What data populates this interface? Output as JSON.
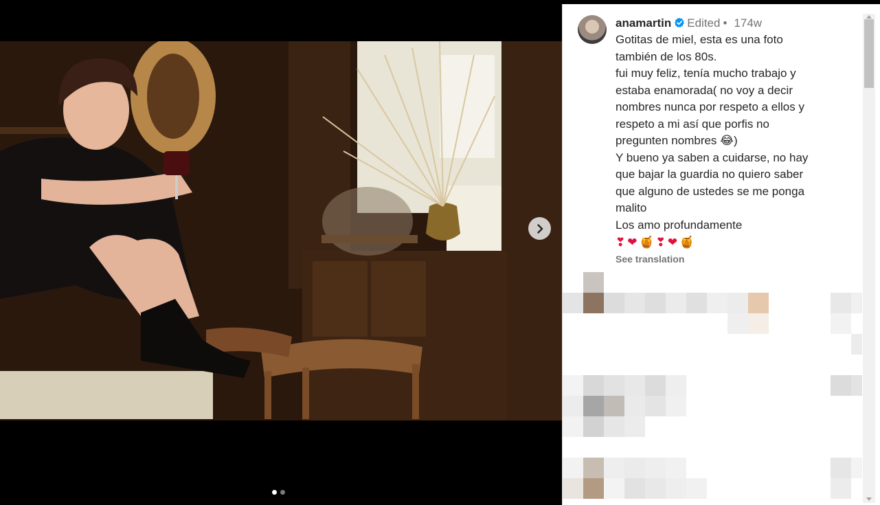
{
  "post": {
    "username": "anamartin",
    "edited": "Edited",
    "separator": "•",
    "time": "174w",
    "caption_lines": [
      "Gotitas de miel, esta es una foto",
      "también de los 80s.",
      "fui muy feliz, tenía mucho trabajo y",
      "estaba enamorada( no voy a decir",
      "nombres nunca por respeto a ellos y",
      "respeto a mi así que porfis no",
      "pregunten nombres 😂)",
      "Y bueno ya saben a cuidarse, no hay",
      "que bajar la guardia no quiero saber",
      "que alguno de ustedes se me ponga",
      "malito",
      "Los amo profundamente"
    ],
    "emoji_line": [
      "❣",
      "❤",
      "🍯",
      "❣",
      "❤",
      "🍯"
    ],
    "see_translation": "See translation"
  },
  "media": {
    "carousel_index": 1,
    "carousel_total": 2,
    "next_icon": "chevron-right-icon"
  },
  "colors": {
    "verified_badge": "#0095f6",
    "heart": "#e0103c",
    "muted_text": "#737373",
    "text": "#262626"
  }
}
